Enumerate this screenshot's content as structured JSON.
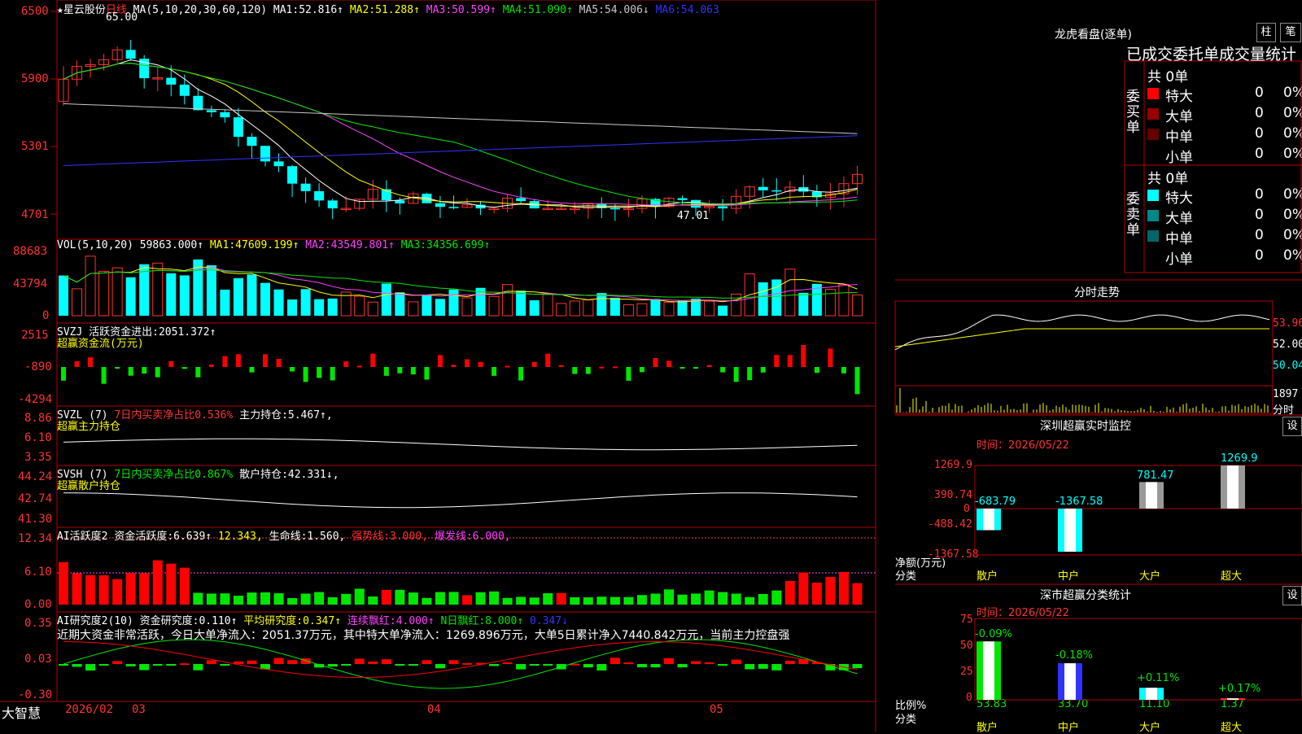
{
  "header": {
    "stock": "★星云股份",
    "period": "日线",
    "ma_label": "MA(5,10,20,30,60,120)",
    "ma": [
      {
        "t": "MA1:",
        "v": "52.816↑",
        "color": "#ffffff"
      },
      {
        "t": "MA2:",
        "v": "51.288↑",
        "color": "#ffff00"
      },
      {
        "t": "MA3:",
        "v": "50.599↑",
        "color": "#ff40ff"
      },
      {
        "t": "MA4:",
        "v": "51.090↑",
        "color": "#00e600"
      },
      {
        "t": "MA5:",
        "v": "54.006↓",
        "color": "#c8c8c8"
      },
      {
        "t": "MA6:",
        "v": "54.063",
        "color": "#3232ff"
      }
    ],
    "high_label": "65.00",
    "low_label": "47.01"
  },
  "panels": {
    "price_ticks": [
      "6500",
      "5900",
      "5301",
      "4701"
    ],
    "vol": {
      "label": "VOL(5,10,20)",
      "value": "59863.000↑",
      "ma": [
        {
          "t": "MA1:",
          "v": "47609.199↑",
          "color": "#ffffff"
        },
        {
          "t": "MA2:",
          "v": "43549.801↑",
          "color": "#ff40ff"
        },
        {
          "t": "MA3:",
          "v": "34356.699↑",
          "color": "#00e600"
        }
      ],
      "ticks": [
        "88683",
        "43794",
        "0"
      ]
    },
    "svzj": {
      "label": "SVZJ",
      "title": "活跃资金进出:",
      "value": "2051.372↑",
      "sub": "超赢资金流(万元)",
      "ticks": [
        "2515",
        "-890",
        "-4294"
      ]
    },
    "svzl": {
      "label": "SVZL (7)",
      "title": "7日内买卖净占比0.536%",
      "extra": "主力持仓:",
      "value": "5.467↑,",
      "sub": "超赢主力持仓",
      "ticks": [
        "8.86",
        "6.10",
        "3.35"
      ]
    },
    "svsh": {
      "label": "SVSH (7)",
      "title": "7日内买卖净占比0.867%",
      "extra": "散户持仓:",
      "value": "42.331↓,",
      "sub": "超赢散户持仓",
      "ticks": [
        "44.24",
        "42.74",
        "41.30"
      ]
    },
    "ai1": {
      "label": "AI活跃度2",
      "t1": "资金活跃度:",
      "v1": "6.639↑",
      "v2": "12.343,",
      "t3": "生命线:",
      "v3": "1.560,",
      "t4": "强势线:",
      "v4": "3.000,",
      "t5": "爆发线:",
      "v5": "6.000,",
      "ticks": [
        "12.34",
        "6.10",
        "0.00"
      ]
    },
    "ai2": {
      "label": "AI研究度2(10)",
      "t1": "资金研究度:",
      "v1": "0.110↑",
      "t2": "平均研究度:",
      "v2": "0.347↑",
      "t3": "连续飘红:",
      "v3": "4.000↑",
      "t4": "N日飘红:",
      "v4": "8.000↑",
      "v5": "0.347↓",
      "comment": "近期大资金非常活跃，今日大单净流入：2051.37万元，其中特大单净流入：1269.896万元，大单5日累计净入7440.842万元，当前主力控盘强",
      "ticks": [
        "0.35",
        "0.03",
        "-0.30"
      ]
    }
  },
  "dates": [
    "2026/02",
    "03",
    "04",
    "05"
  ],
  "brand": "大智慧",
  "right": {
    "lhb_title": "龙虎看盘(逐单)",
    "btn_zhu": "柱",
    "btn_bi": "笔",
    "stat_title": "已成交委托单成交量统计",
    "buy_side": "委买单",
    "sell_side": "委卖单",
    "buy_total": "共 0单",
    "sell_total": "共 0单",
    "rows": [
      {
        "name": "特大",
        "val": "0",
        "pct": "0%",
        "color": "#ff0000"
      },
      {
        "name": "大单",
        "val": "0",
        "pct": "0%",
        "color": "#990000"
      },
      {
        "name": "中单",
        "val": "0",
        "pct": "0%",
        "color": "#660000"
      },
      {
        "name": "小单",
        "val": "0",
        "pct": "0%",
        "color": ""
      }
    ],
    "sell_rows": [
      {
        "name": "特大",
        "val": "0",
        "pct": "0%",
        "color": "#00ffff"
      },
      {
        "name": "大单",
        "val": "0",
        "pct": "0%",
        "color": "#008888"
      },
      {
        "name": "中单",
        "val": "0",
        "pct": "0%",
        "color": "#006666"
      },
      {
        "name": "小单",
        "val": "0",
        "pct": "0%",
        "color": ""
      }
    ],
    "fs_title": "分时走势",
    "fs_ticks": [
      "53.96",
      "52.00",
      "50.04",
      "1897",
      "分时"
    ],
    "monitor_title": "深圳超赢实时监控",
    "btn_set": "设",
    "monitor_time": "时间：2026/05/22",
    "monitor_ticks": [
      "1269.9",
      "390.74",
      "0",
      "-488.42",
      "-1367.58"
    ],
    "monitor_axis": "净额(万元)",
    "monitor_cat_label": "分类",
    "stat2_title": "深市超赢分类统计",
    "stat2_time": "时间：2026/05/22",
    "stat2_ticks": [
      "75",
      "50",
      "25",
      "0"
    ],
    "stat2_axis": "比例%",
    "stat2_cat_label": "分类"
  },
  "chart_data": [
    {
      "type": "bar",
      "title": "深圳超赢实时监控",
      "categories": [
        "散户",
        "中户",
        "大户",
        "超大"
      ],
      "values": [
        -683.79,
        -1367.58,
        781.47,
        1269.9
      ],
      "value_labels": [
        "-683.79",
        "-1367.58",
        "781.47",
        "1269.9"
      ],
      "ylabel": "净额(万元)",
      "ylim": [
        -1367.58,
        1269.9
      ]
    },
    {
      "type": "bar",
      "title": "深市超赢分类统计",
      "categories": [
        "散户",
        "中户",
        "大户",
        "超大"
      ],
      "values": [
        53.83,
        33.7,
        11.1,
        1.37
      ],
      "value_labels": [
        "53.83",
        "33.70",
        "11.10",
        "1.37"
      ],
      "change_labels": [
        "-0.09%",
        "-0.18%",
        "+0.11%",
        "+0.17%"
      ],
      "ylabel": "比例%",
      "ylim": [
        0,
        75
      ]
    }
  ]
}
